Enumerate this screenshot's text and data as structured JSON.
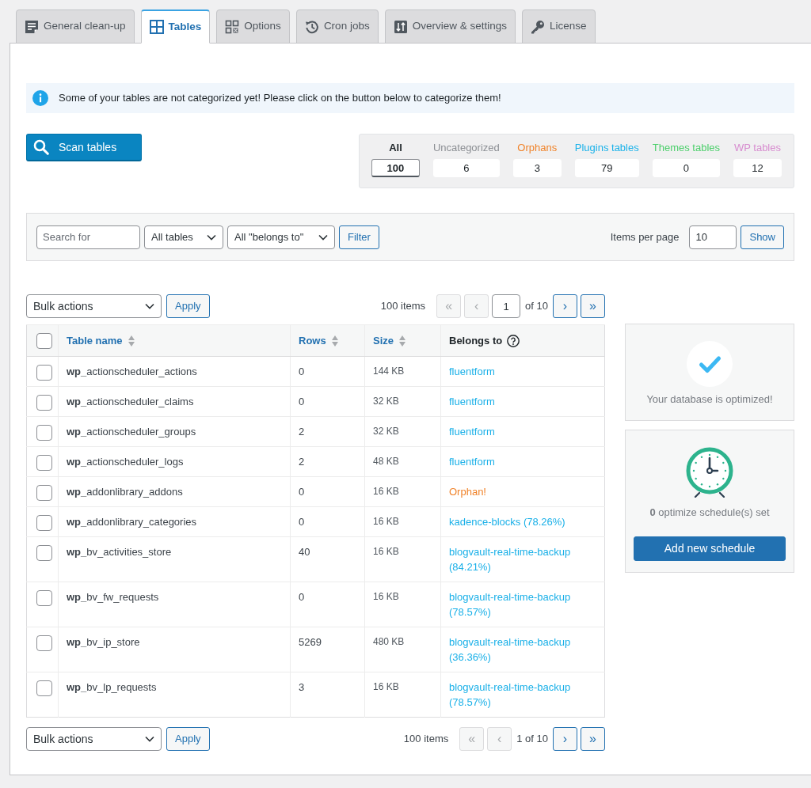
{
  "tabs": [
    {
      "label": "General clean-up",
      "selected": false
    },
    {
      "label": "Tables",
      "selected": true
    },
    {
      "label": "Options",
      "selected": false
    },
    {
      "label": "Cron jobs",
      "selected": false
    },
    {
      "label": "Overview & settings",
      "selected": false
    },
    {
      "label": "License",
      "selected": false
    }
  ],
  "notice": {
    "text": "Some of your tables are not categorized yet! Please click on the button below to categorize them!"
  },
  "scan_button": "Scan tables",
  "counts": [
    {
      "label": "All",
      "value": "100",
      "selected": true,
      "color": "#1d2327"
    },
    {
      "label": "Uncategorized",
      "value": "6",
      "selected": false,
      "color": "#8c8f94"
    },
    {
      "label": "Orphans",
      "value": "3",
      "selected": false,
      "color": "#f0832a"
    },
    {
      "label": "Plugins tables",
      "value": "79",
      "selected": false,
      "color": "#1ab2ea"
    },
    {
      "label": "Themes tables",
      "value": "0",
      "selected": false,
      "color": "#4ccf6b"
    },
    {
      "label": "WP tables",
      "value": "12",
      "selected": false,
      "color": "#d78ccf"
    }
  ],
  "filter_bar": {
    "search": {
      "placeholder": "Search for"
    },
    "table_type": "All tables",
    "belongs_to": "All \"belongs to\"",
    "filter_button": "Filter",
    "per_page_label": "Items per page",
    "per_page_value": "10",
    "show_button": "Show"
  },
  "nav_top": {
    "bulk_actions": "Bulk actions",
    "apply": "Apply",
    "items": "100 items",
    "before": [
      {
        "label": "«",
        "disabled": true
      },
      {
        "label": "‹",
        "disabled": true
      }
    ],
    "current_page": "1",
    "total_pages": "of 10",
    "after": [
      {
        "label": "›",
        "disabled": false
      },
      {
        "label": "»",
        "disabled": false
      }
    ]
  },
  "table": {
    "select_all": false,
    "columns": [
      {
        "label": "Table name",
        "sortable": true
      },
      {
        "label": "Rows",
        "sortable": true
      },
      {
        "label": "Size",
        "sortable": true
      },
      {
        "label": "Belongs to",
        "sortable": false
      }
    ],
    "rows": [
      {
        "checked": false,
        "name": "**wp_**actionscheduler_actions",
        "rows": "0",
        "size": "144 KB",
        "belongs_to": {
          "kind": "plugin",
          "text": "fluentform"
        }
      },
      {
        "checked": false,
        "name": "**wp_**actionscheduler_claims",
        "rows": "0",
        "size": "32 KB",
        "belongs_to": {
          "kind": "plugin",
          "text": "fluentform"
        }
      },
      {
        "checked": false,
        "name": "**wp_**actionscheduler_groups",
        "rows": "2",
        "size": "32 KB",
        "belongs_to": {
          "kind": "plugin",
          "text": "fluentform"
        }
      },
      {
        "checked": false,
        "name": "**wp_**actionscheduler_logs",
        "rows": "2",
        "size": "48 KB",
        "belongs_to": {
          "kind": "plugin",
          "text": "fluentform"
        }
      },
      {
        "checked": false,
        "name": "**wp_**addonlibrary_addons",
        "rows": "0",
        "size": "16 KB",
        "belongs_to": {
          "kind": "orphan",
          "text": "Orphan!"
        }
      },
      {
        "checked": false,
        "name": "**wp_**addonlibrary_categories",
        "rows": "0",
        "size": "16 KB",
        "belongs_to": {
          "kind": "plugin",
          "text": "kadence-blocks (78.26%)"
        }
      },
      {
        "checked": false,
        "name": "**wp_**bv_activities_store",
        "rows": "40",
        "size": "16 KB",
        "belongs_to": {
          "kind": "plugin",
          "text": "blogvault-real-time-backup (84.21%)"
        }
      },
      {
        "checked": false,
        "name": "**wp_**bv_fw_requests",
        "rows": "0",
        "size": "16 KB",
        "belongs_to": {
          "kind": "plugin",
          "text": "blogvault-real-time-backup (78.57%)"
        }
      },
      {
        "checked": false,
        "name": "**wp_**bv_ip_store",
        "rows": "5269",
        "size": "480 KB",
        "belongs_to": {
          "kind": "plugin",
          "text": "blogvault-real-time-backup (36.36%)"
        }
      },
      {
        "checked": false,
        "name": "**wp_**bv_lp_requests",
        "rows": "3",
        "size": "16 KB",
        "belongs_to": {
          "kind": "plugin",
          "text": "blogvault-real-time-backup (78.57%)"
        }
      }
    ]
  },
  "nav_bottom": {
    "bulk_actions": "Bulk actions",
    "apply": "Apply",
    "items": "100 items",
    "before": [
      {
        "label": "«",
        "disabled": true
      },
      {
        "label": "‹",
        "disabled": true
      }
    ],
    "page_label": "1 of 10",
    "after": [
      {
        "label": "›",
        "disabled": false
      },
      {
        "label": "»",
        "disabled": false
      }
    ]
  },
  "status_card": {
    "message": "Your database is optimized!"
  },
  "schedule_card": {
    "summary": "**0** optimize schedule(s) set",
    "button": "Add new schedule"
  }
}
